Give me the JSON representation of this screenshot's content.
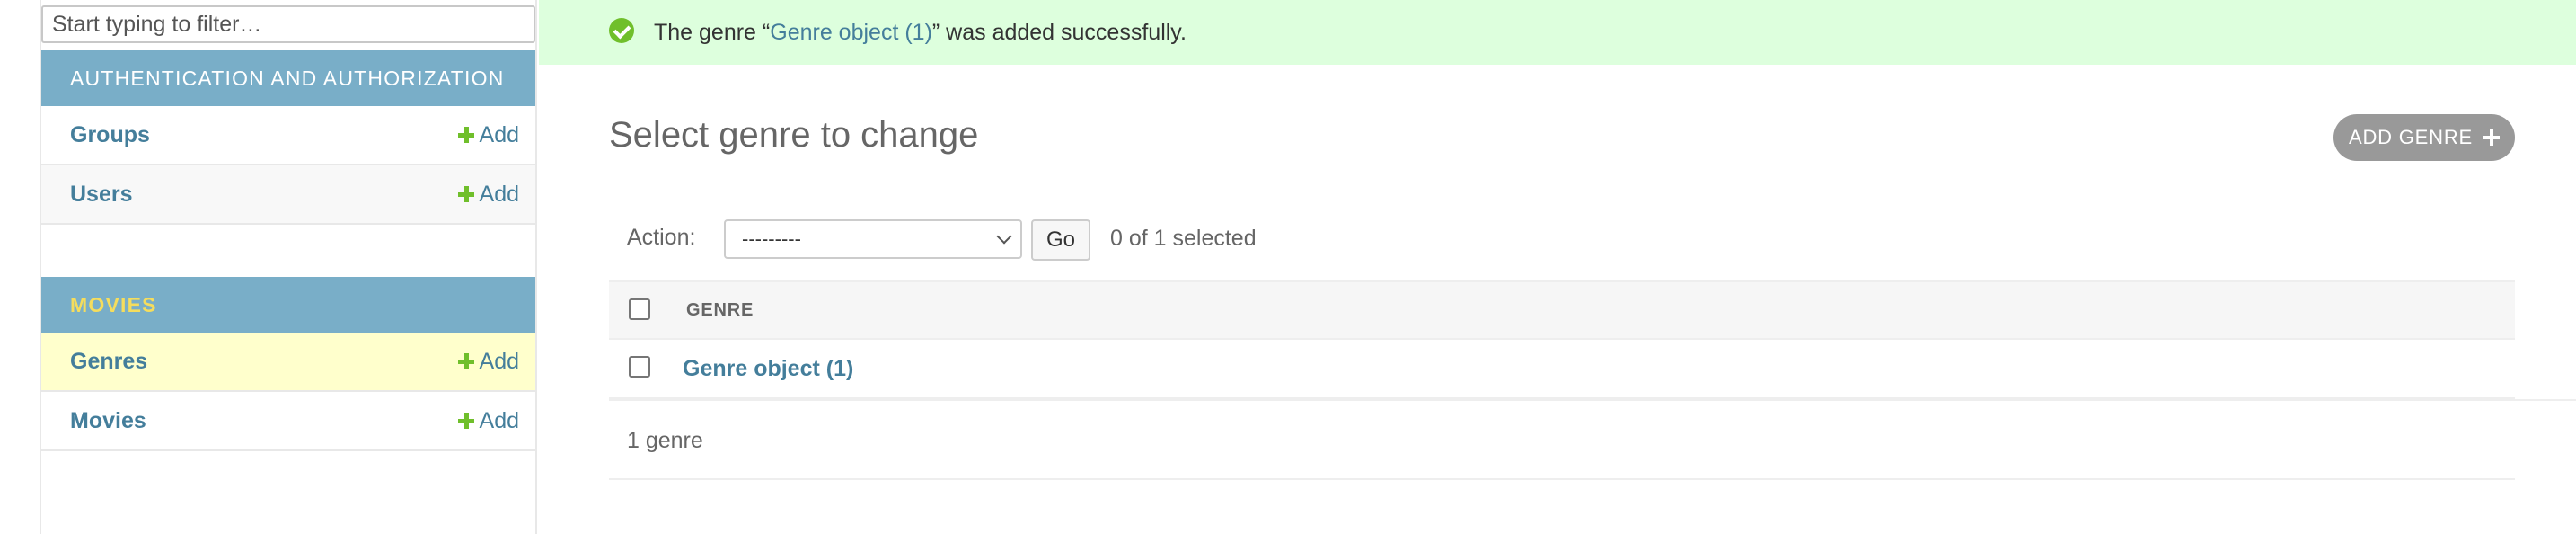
{
  "sidebar": {
    "filter_placeholder": "Start typing to filter…",
    "apps": [
      {
        "caption": "AUTHENTICATION AND AUTHORIZATION",
        "models": [
          {
            "label": "Groups",
            "add_label": "Add"
          },
          {
            "label": "Users",
            "add_label": "Add"
          }
        ]
      },
      {
        "caption": "MOVIES",
        "models": [
          {
            "label": "Genres",
            "add_label": "Add"
          },
          {
            "label": "Movies",
            "add_label": "Add"
          }
        ]
      }
    ]
  },
  "message": {
    "prefix": "The genre “",
    "link_text": "Genre object (1)",
    "suffix": "” was added successfully."
  },
  "content": {
    "title": "Select genre to change",
    "add_button_label": "ADD GENRE",
    "actions": {
      "label": "Action:",
      "selected_option": "---------",
      "go_label": "Go",
      "selection_count": "0 of 1 selected"
    },
    "table": {
      "column_header": "GENRE",
      "rows": [
        {
          "label": "Genre object (1)"
        }
      ]
    },
    "paginator": "1 genre"
  },
  "colors": {
    "module_header": "#79aec8",
    "link": "#447e9b",
    "success_bg": "#dfd",
    "add_green": "#70bf2b",
    "current_row": "#ffffcc",
    "button_gray": "#999999"
  }
}
